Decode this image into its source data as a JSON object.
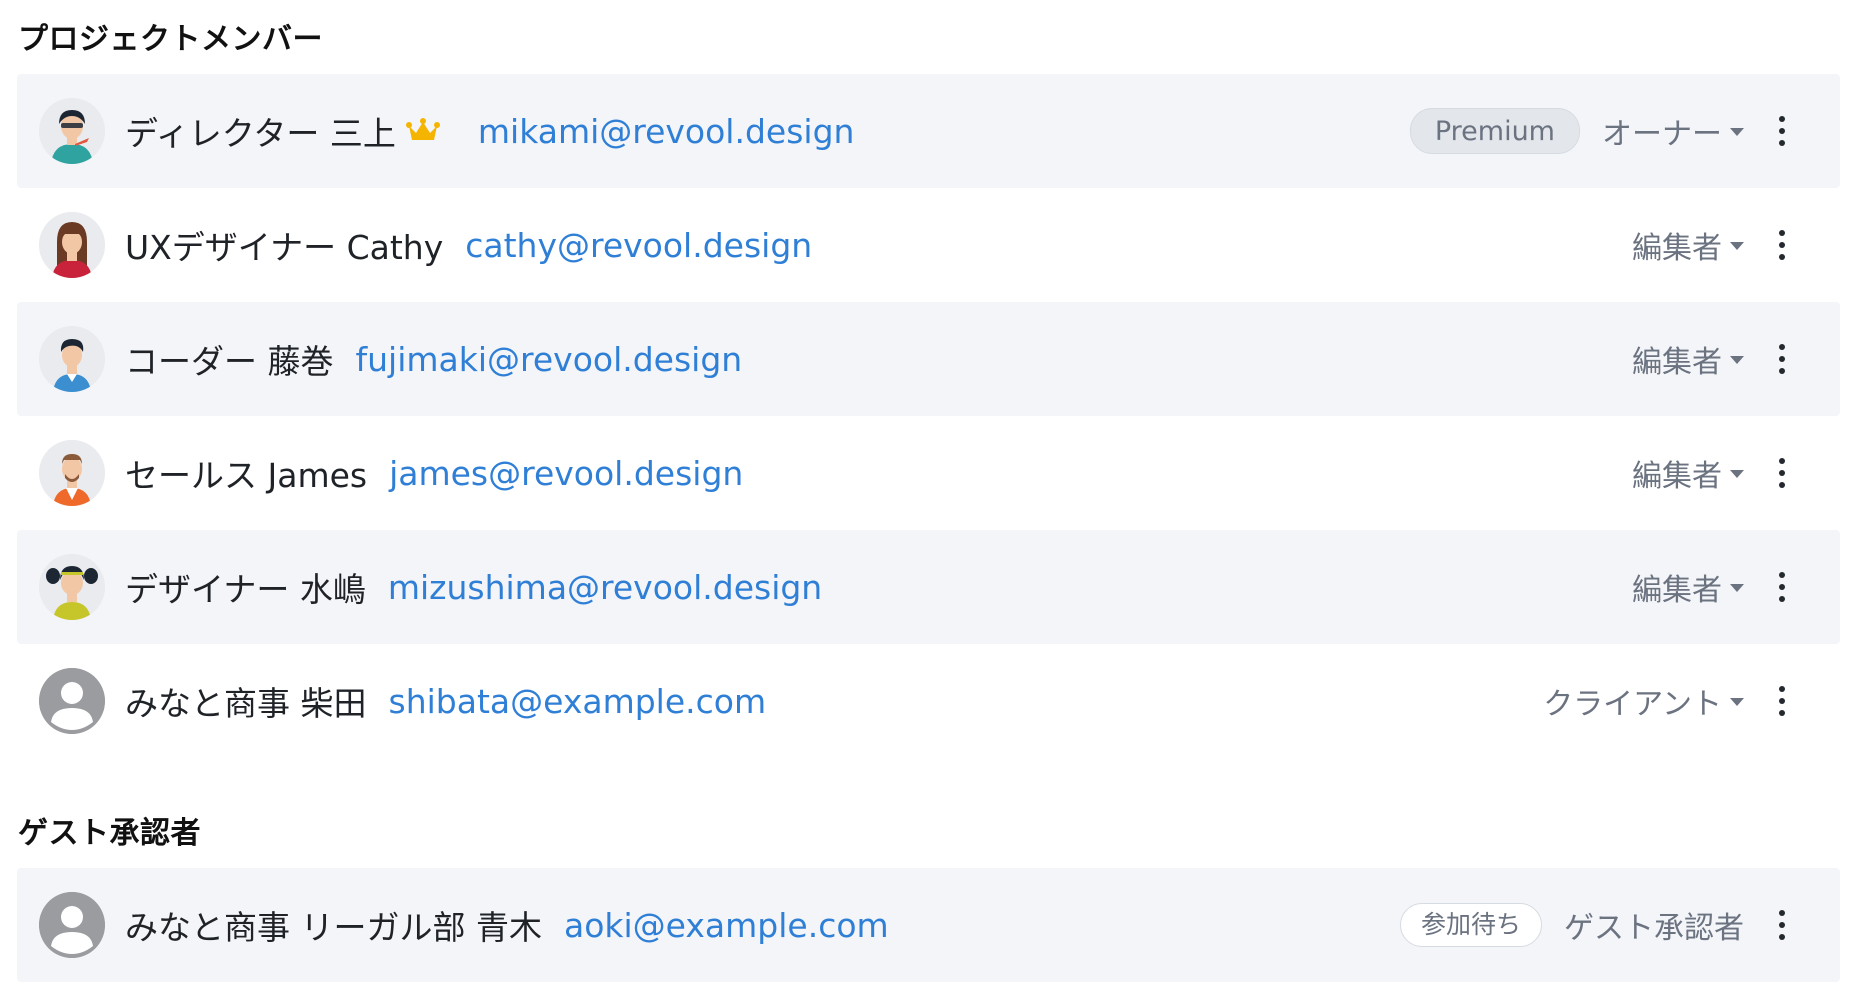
{
  "sections": {
    "members_title": "プロジェクトメンバー",
    "guests_title": "ゲスト承認者"
  },
  "members": [
    {
      "name": "ディレクター 三上",
      "email": "mikami@revool.design",
      "badge": "Premium",
      "role": "オーナー",
      "avatar": "avatar-director-icon",
      "crown": "crown-icon"
    },
    {
      "name": "UXデザイナー Cathy",
      "email": "cathy@revool.design",
      "role": "編集者",
      "avatar": "avatar-woman-icon"
    },
    {
      "name": "コーダー 藤巻",
      "email": "fujimaki@revool.design",
      "role": "編集者",
      "avatar": "avatar-man-icon"
    },
    {
      "name": "セールス James",
      "email": "james@revool.design",
      "role": "編集者",
      "avatar": "avatar-bearded-man-icon"
    },
    {
      "name": "デザイナー 水嶋",
      "email": "mizushima@revool.design",
      "role": "編集者",
      "avatar": "avatar-pigtails-icon"
    },
    {
      "name": "みなと商事 柴田",
      "email": "shibata@example.com",
      "role": "クライアント",
      "avatar": "avatar-placeholder-icon"
    }
  ],
  "guests": [
    {
      "name": "みなと商事 リーガル部 青木",
      "email": "aoki@example.com",
      "badge": "参加待ち",
      "role": "ゲスト承認者",
      "avatar": "avatar-placeholder-icon"
    }
  ],
  "colors": {
    "row_shade": "#f3f5f8",
    "email_link": "#2f7fd6",
    "role_text": "#6b7280",
    "crown": "#f4b400"
  }
}
